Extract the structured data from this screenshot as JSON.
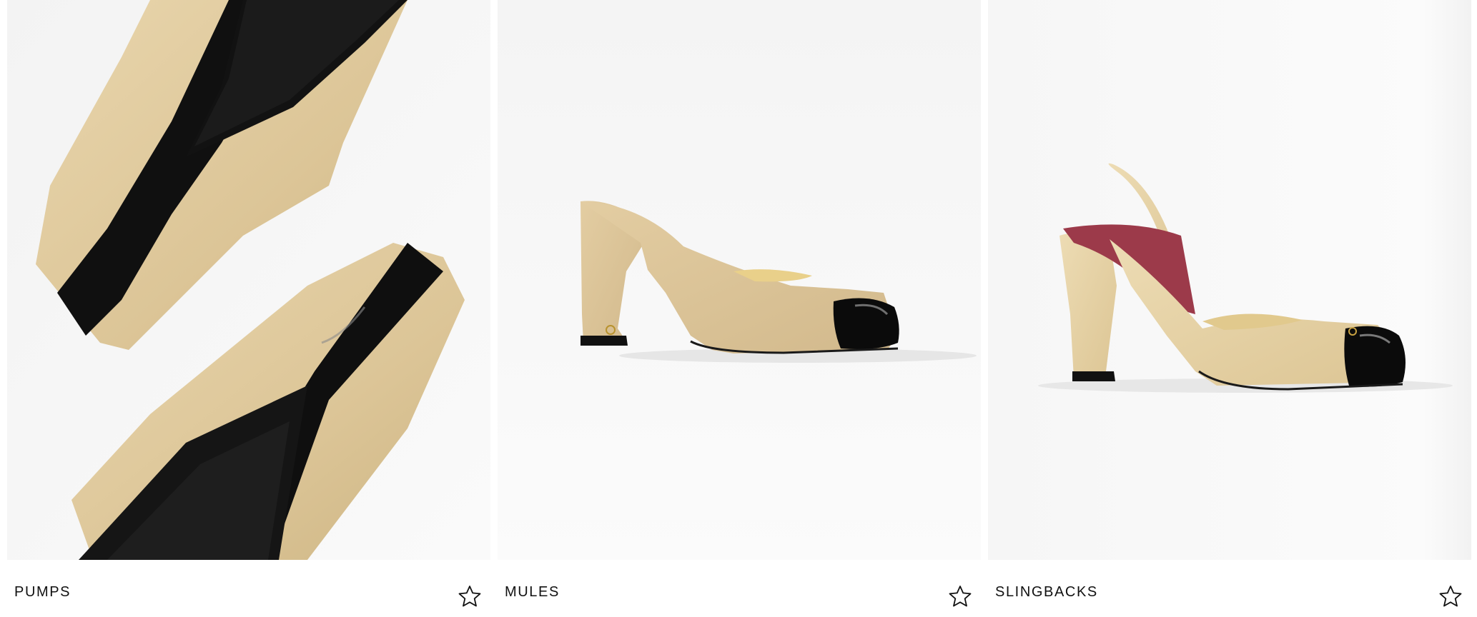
{
  "products": [
    {
      "name": "PUMPS",
      "favorite_icon": "star-outline-icon",
      "image": "beige suede pump with black patent cap toe, close-up"
    },
    {
      "name": "MULES",
      "favorite_icon": "star-outline-icon",
      "image": "beige suede mule with black patent cap toe"
    },
    {
      "name": "SLINGBACKS",
      "favorite_icon": "star-outline-icon",
      "image": "beige leather slingback with black patent cap toe"
    }
  ],
  "colors": {
    "background": "#ffffff",
    "text": "#111111",
    "beige": "#e6d2ad",
    "black_patent": "#0d0d0d"
  }
}
